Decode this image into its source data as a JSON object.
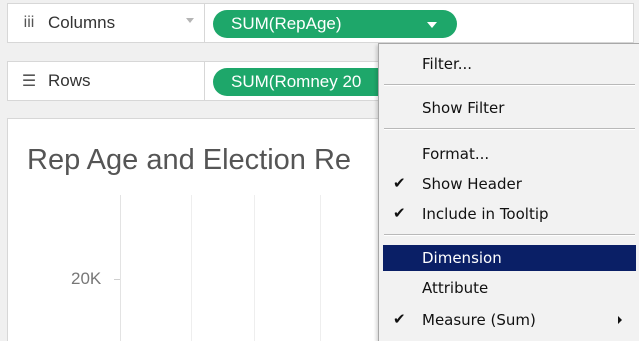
{
  "shelves": {
    "columns": {
      "icon": "columns-icon",
      "icon_glyph": "iii",
      "label": "Columns",
      "pill_label": "SUM(RepAge)"
    },
    "rows": {
      "icon": "rows-icon",
      "icon_glyph": "☰",
      "label": "Rows",
      "pill_label": "SUM(Romney 20"
    }
  },
  "viz": {
    "title": "Rep Age and Election Re",
    "y_tick": "20K"
  },
  "context_menu": {
    "items": [
      {
        "label": "Filter...",
        "checked": false
      },
      {
        "label": "Show Filter",
        "checked": false
      },
      {
        "label": "Format...",
        "checked": false
      },
      {
        "label": "Show Header",
        "checked": true,
        "check_glyph": "✔"
      },
      {
        "label": "Include in Tooltip",
        "checked": true,
        "check_glyph": "✔"
      },
      {
        "label": "Dimension",
        "checked": false,
        "selected": true
      },
      {
        "label": "Attribute",
        "checked": false
      },
      {
        "label": "Measure (Sum)",
        "checked": true,
        "check_glyph": "✔",
        "has_submenu": true
      }
    ]
  },
  "colors": {
    "pill_green": "#1ea76a",
    "menu_highlight": "#0a1f66"
  }
}
